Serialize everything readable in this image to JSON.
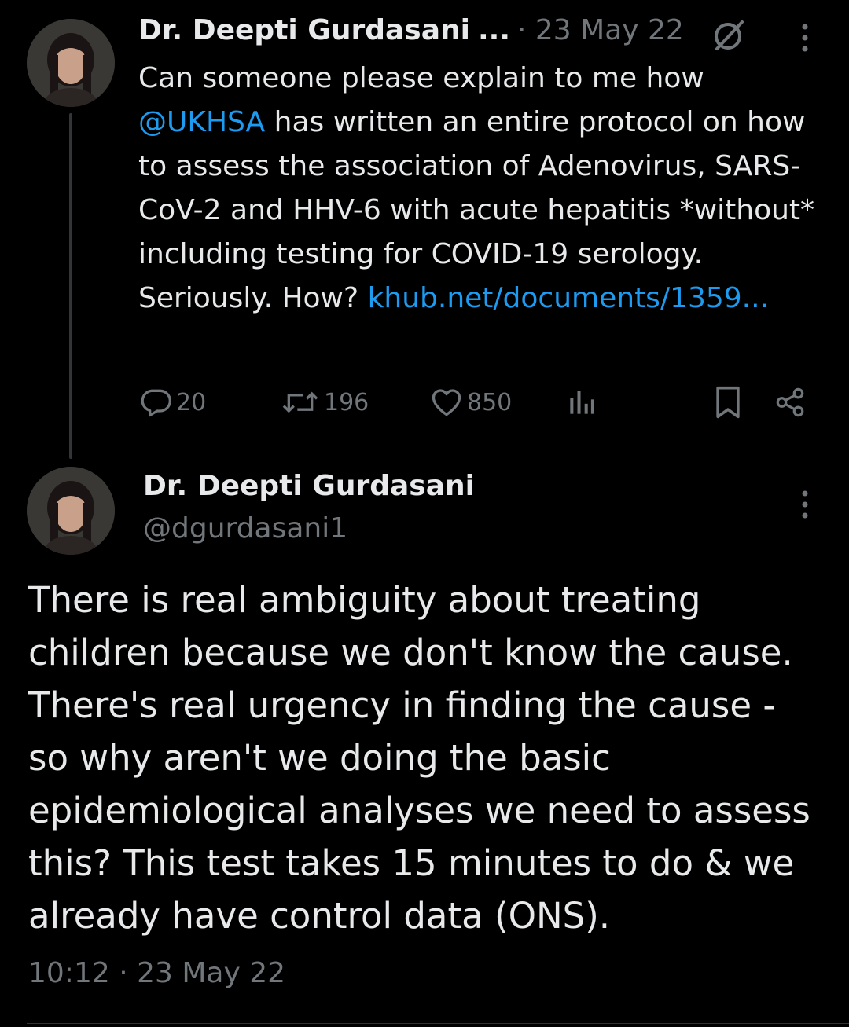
{
  "tweet1": {
    "author_name": "Dr. Deepti Gurdasani",
    "name_truncation": "...",
    "date": "· 23 May 22",
    "body_intro": "Can someone please explain to me how",
    "mention": "@UKHSA",
    "body_rest": " has written an entire protocol on how to assess the association of Adenovirus, SARS-CoV-2 and HHV-6 with acute hepatitis *without* including testing for COVID-19 serology. Seriously. How?",
    "link_text": "khub.net/documents/1359...",
    "actions": {
      "replies": "20",
      "retweets": "196",
      "likes": "850"
    }
  },
  "tweet2": {
    "author_name": "Dr. Deepti Gurdasani",
    "handle": "@dgurdasani1",
    "body": "There is real ambiguity about treating children because we don't know the cause. There's real urgency in finding the cause - so why aren't we doing the basic epidemiological analyses we need to assess this? This test takes 15 minutes to do & we already have control data (ONS).",
    "timestamp": "10:12 · 23 May 22"
  },
  "colors": {
    "background": "#000000",
    "text_primary": "#e7e9ea",
    "text_secondary": "#71767b",
    "link": "#1d9bf0",
    "divider": "#2f3336"
  },
  "icons": {
    "reply": "reply-icon",
    "retweet": "retweet-icon",
    "like": "heart-icon",
    "views": "views-icon",
    "bookmark": "bookmark-icon",
    "share": "share-icon",
    "more": "more-icon",
    "no_entry": "no-entry-icon"
  }
}
